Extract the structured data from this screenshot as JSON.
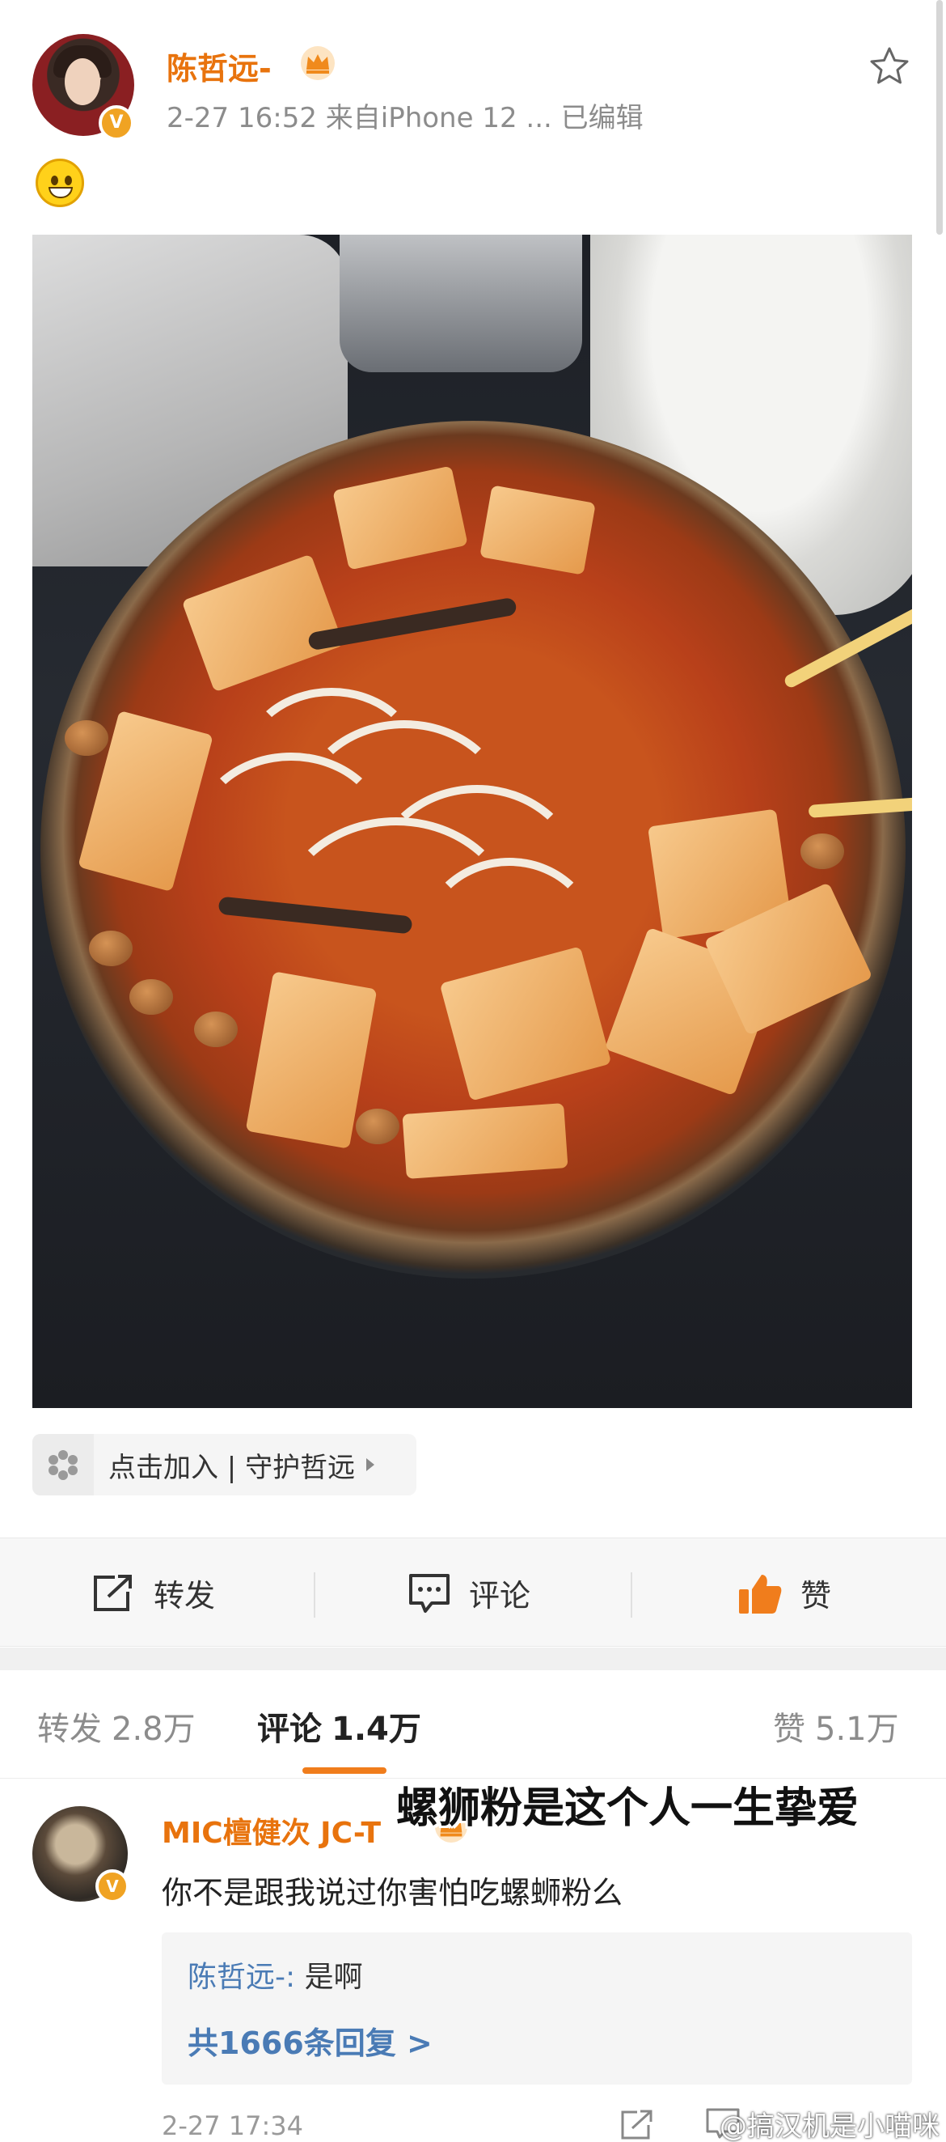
{
  "post": {
    "author": "陈哲远-",
    "meta": "2-27 16:52  来自iPhone 12 ...  已编辑",
    "guard_label": "点击加入 | 守护哲远",
    "colors": {
      "username": "#e8730d",
      "link": "#4a7bb5",
      "like": "#f07d1c"
    }
  },
  "actions": {
    "repost_label": "转发",
    "comment_label": "评论",
    "like_label": "赞"
  },
  "tabs": {
    "repost_label": "转发",
    "repost_count": "2.8万",
    "comment_label": "评论",
    "comment_count": "1.4万",
    "like_label": "赞",
    "like_count": "5.1万"
  },
  "overlay_caption": "螺狮粉是这个人一生挚爱",
  "comment": {
    "author": "MIC檀健次 JC-T",
    "text": "你不是跟我说过你害怕吃螺蛳粉么",
    "reply_user": "陈哲远-:",
    "reply_text": " 是啊",
    "reply_more": "共1666条回复 >",
    "time": "2-27 17:34"
  },
  "watermark": "@搞汉机是小喵咪",
  "icons": {
    "verified": "verified-badge-icon",
    "crown": "crown-icon",
    "star": "star-outline-icon",
    "repost": "repost-icon",
    "comment": "comment-icon",
    "like": "thumbs-up-icon"
  }
}
